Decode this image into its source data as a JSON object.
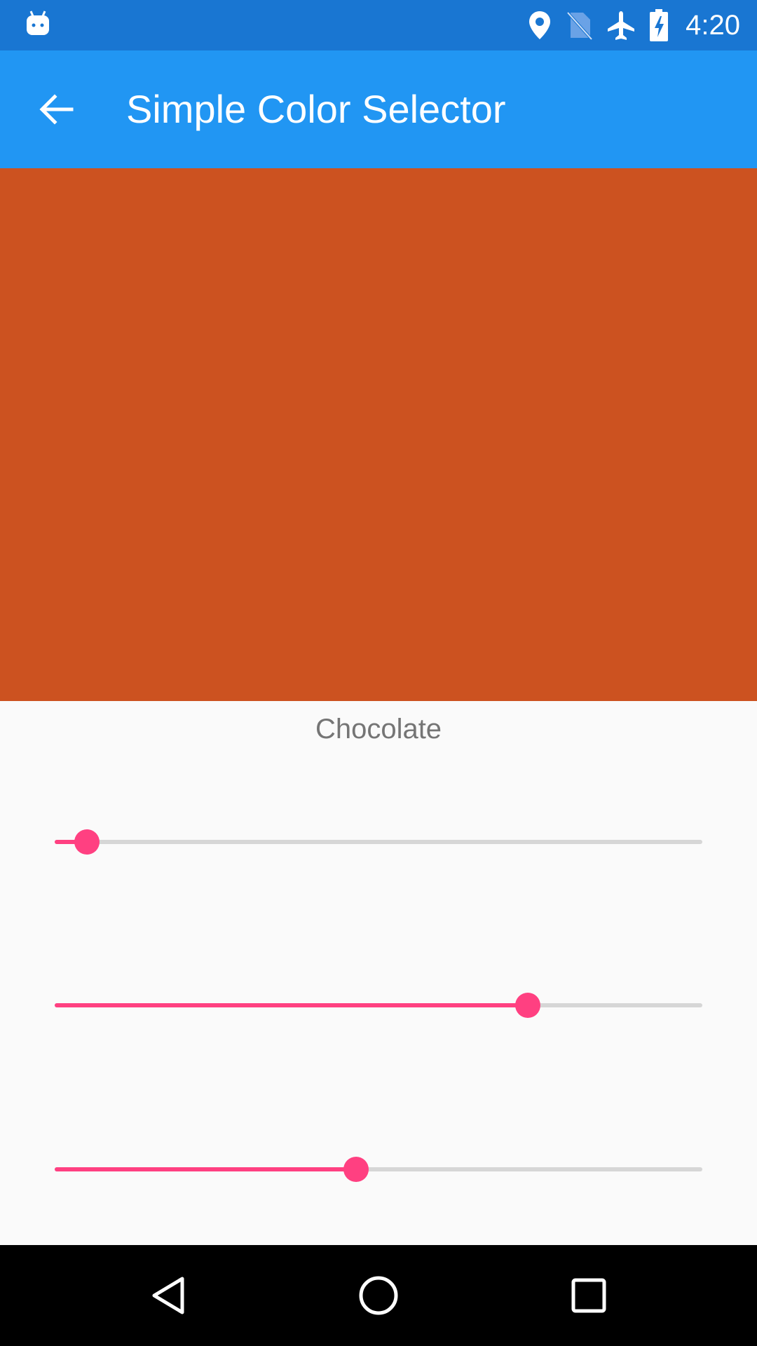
{
  "status_bar": {
    "time": "4:20",
    "icons": [
      "android-notification-icon",
      "location-icon",
      "no-sim-icon",
      "airplane-mode-icon",
      "battery-charging-icon"
    ],
    "background": "#1976d2"
  },
  "app_bar": {
    "title": "Simple Color Selector",
    "back_icon": "arrow-back-icon",
    "background": "#2196f3"
  },
  "preview": {
    "color": "#cc5220"
  },
  "color_name": "Chocolate",
  "sliders": [
    {
      "name": "slider-red",
      "value": 0.05,
      "accent": "#ff4081"
    },
    {
      "name": "slider-green",
      "value": 0.73,
      "accent": "#ff4081"
    },
    {
      "name": "slider-blue",
      "value": 0.465,
      "accent": "#ff4081"
    }
  ],
  "nav_bar": {
    "buttons": [
      "back-triangle-icon",
      "home-circle-icon",
      "recents-square-icon"
    ]
  }
}
